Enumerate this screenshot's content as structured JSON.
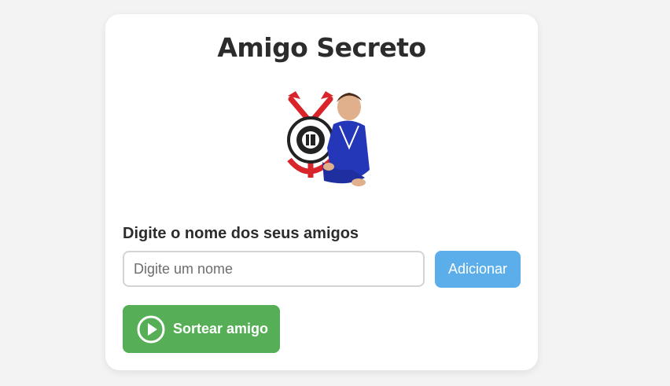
{
  "page": {
    "title": "Amigo Secreto"
  },
  "form": {
    "label": "Digite o nome dos seus amigos",
    "input_value": "",
    "input_placeholder": "Digite um nome",
    "add_button_label": "Adicionar",
    "draw_button_label": "Sortear amigo",
    "draw_button_icon": "play-circle-icon"
  },
  "colors": {
    "background": "#f3f3f3",
    "card": "#ffffff",
    "add_button": "#5baeea",
    "draw_button": "#56af56",
    "text": "#2c2c2c"
  }
}
